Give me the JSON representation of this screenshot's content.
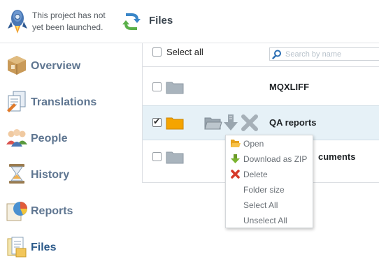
{
  "header": {
    "status_text": "This project has not yet been launched.",
    "title": "Files"
  },
  "sidebar": {
    "items": [
      {
        "label": "Overview",
        "icon": "box-icon",
        "active": false
      },
      {
        "label": "Translations",
        "icon": "documents-icon",
        "active": false
      },
      {
        "label": "People",
        "icon": "people-icon",
        "active": false
      },
      {
        "label": "History",
        "icon": "hourglass-icon",
        "active": false
      },
      {
        "label": "Reports",
        "icon": "pie-chart-icon",
        "active": false
      },
      {
        "label": "Files",
        "icon": "files-icon",
        "active": true
      }
    ]
  },
  "files": {
    "select_all_label": "Select all",
    "search_placeholder": "Search by name",
    "rows": [
      {
        "name": "MQXLIFF",
        "checked": false,
        "selected": false
      },
      {
        "name": "QA reports",
        "checked": true,
        "selected": true
      },
      {
        "name": "cuments",
        "checked": false,
        "selected": false
      }
    ]
  },
  "context_menu": {
    "items": [
      {
        "label": "Open",
        "icon": "open-folder-icon"
      },
      {
        "label": "Download as ZIP",
        "icon": "download-icon"
      },
      {
        "label": "Delete",
        "icon": "delete-icon"
      },
      {
        "label": "Folder size",
        "icon": ""
      },
      {
        "label": "Select All",
        "icon": ""
      },
      {
        "label": "Unselect All",
        "icon": ""
      }
    ]
  },
  "colors": {
    "nav_text": "#5e7590",
    "selected_row": "#e6f1f7",
    "folder_gray": "#a9b4bd",
    "folder_orange": "#f5a400"
  }
}
